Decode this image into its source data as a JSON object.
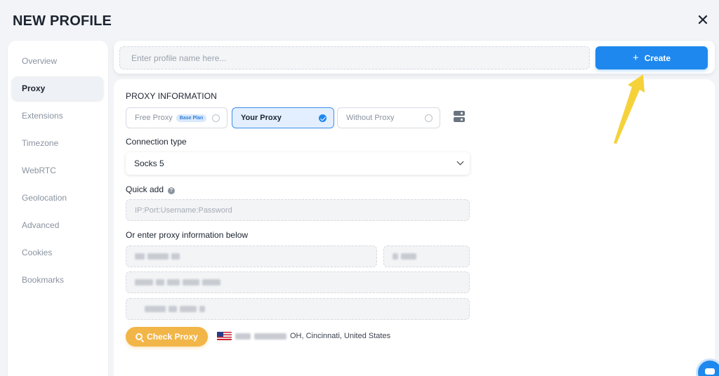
{
  "window": {
    "title": "NEW PROFILE",
    "close_glyph": "✕"
  },
  "sidebar": {
    "items": [
      {
        "label": "Overview",
        "active": false
      },
      {
        "label": "Proxy",
        "active": true
      },
      {
        "label": "Extensions",
        "active": false
      },
      {
        "label": "Timezone",
        "active": false
      },
      {
        "label": "WebRTC",
        "active": false
      },
      {
        "label": "Geolocation",
        "active": false
      },
      {
        "label": "Advanced",
        "active": false
      },
      {
        "label": "Cookies",
        "active": false
      },
      {
        "label": "Bookmarks",
        "active": false
      }
    ]
  },
  "topbar": {
    "profile_name_placeholder": "Enter profile name here...",
    "create_label": "Create"
  },
  "proxy": {
    "section_title": "PROXY INFORMATION",
    "options": {
      "free": {
        "label": "Free Proxy",
        "badge": "Base Plan",
        "selected": false
      },
      "yours": {
        "label": "Your Proxy",
        "selected": true
      },
      "none": {
        "label": "Without Proxy",
        "selected": false
      }
    },
    "connection_type_label": "Connection type",
    "connection_type_value": "Socks 5",
    "quick_add_label": "Quick add",
    "quick_add_placeholder": "IP:Port:Username:Password",
    "manual_label": "Or enter proxy information below",
    "check_label": "Check Proxy",
    "location_text": "OH, Cincinnati, United States"
  },
  "colors": {
    "accent_blue": "#1e88ee",
    "check_button": "#f2b547",
    "arrow": "#f5d23a"
  }
}
